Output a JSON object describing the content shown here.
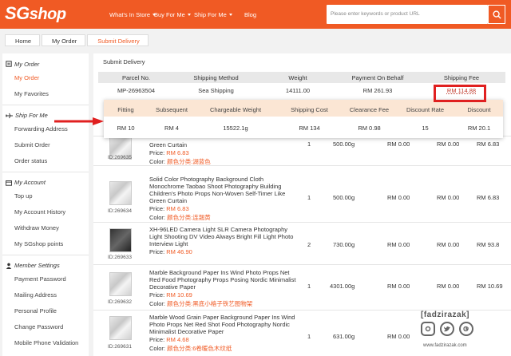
{
  "header": {
    "logo_prefix": "SG",
    "logo_suffix": "shop",
    "nav": [
      "What's In Store",
      "Buy For Me",
      "Ship For Me",
      "Blog"
    ],
    "search_placeholder": "Please enter keywords or product URL"
  },
  "breadcrumb": [
    "Home",
    "My Order",
    "Submit Delivery"
  ],
  "sidebar": {
    "sections": [
      {
        "title": "My Order",
        "icon": "cart-icon",
        "items": [
          "My Order",
          "My Favorites"
        ]
      },
      {
        "title": "Ship For Me",
        "icon": "plane-icon",
        "items": [
          "Forwarding Address",
          "Submit Order",
          "Order status"
        ]
      },
      {
        "title": "My Account",
        "icon": "account-icon",
        "items": [
          "Top up",
          "My Account History",
          "Withdraw Money",
          "My SGshop points"
        ]
      },
      {
        "title": "Member Settings",
        "icon": "user-icon",
        "items": [
          "Payment Password",
          "Mailing Address",
          "Personal Profile",
          "Change Password",
          "Mobile Phone Validation"
        ]
      }
    ],
    "active_item": "My Order"
  },
  "main": {
    "title": "Submit Delivery",
    "shipment": {
      "headers": [
        "Parcel No.",
        "Shipping Method",
        "Weight",
        "Payment On Behalf",
        "Shipping Fee"
      ],
      "row": [
        "MP-26963504",
        "Sea Shipping",
        "14111.00",
        "RM 261.93",
        "RM 114.88"
      ]
    },
    "fee_detail": {
      "headers": [
        "Fitting",
        "Subsequent",
        "Chargeable Weight",
        "Shipping Cost",
        "Clearance Fee",
        "Discount Rate",
        "Discount"
      ],
      "row": [
        "RM 10",
        "RM 4",
        "15522.1g",
        "RM 134",
        "RM 0.98",
        "15",
        "RM 20.1"
      ]
    }
  },
  "products": [
    {
      "name_lines": [
        "Green Curtain"
      ],
      "price_label": "Price:",
      "price": "RM 6.83",
      "color_label": "Color:",
      "color": "颜色分类:湖蓝色",
      "id": "ID:269635",
      "qty": "1",
      "weight": "500.00g",
      "c1": "RM 0.00",
      "c2": "RM 0.00",
      "c3": "RM 6.83"
    },
    {
      "name_lines": [
        "Solid Color Photography Background Cloth",
        "Monochrome Taobao Shoot Photography Building",
        "Children's Photo Props Non-Woven Self-Timer Like",
        "Green Curtain"
      ],
      "price_label": "Price:",
      "price": "RM 6.83",
      "color_label": "Color:",
      "color": "颜色分类:连翘黄",
      "id": "ID:269634",
      "qty": "1",
      "weight": "500.00g",
      "c1": "RM 0.00",
      "c2": "RM 0.00",
      "c3": "RM 6.83"
    },
    {
      "name_lines": [
        "XH-96LED Camera Light SLR Camera Photography",
        "Light Shooting DV Video Always Bright Fill Light Photo",
        "Interview Light"
      ],
      "price_label": "Price:",
      "price": "RM 46.90",
      "color_label": "",
      "color": "",
      "id": "ID:269633",
      "qty": "2",
      "weight": "730.00g",
      "c1": "RM 0.00",
      "c2": "RM 0.00",
      "c3": "RM 93.8"
    },
    {
      "name_lines": [
        "Marble Background Paper Ins Wind Photo Props Net",
        "Red Food Photography Props Posing Nordic Minimalist",
        "Decorative Paper"
      ],
      "price_label": "Price:",
      "price": "RM 10.69",
      "color_label": "Color:",
      "color": "颜色分类:黑底小格子铁艺图物架",
      "id": "ID:269632",
      "qty": "1",
      "weight": "4301.00g",
      "c1": "RM 0.00",
      "c2": "RM 0.00",
      "c3": "RM 10.69"
    },
    {
      "name_lines": [
        "Marble Wood Grain Paper Background Paper Ins Wind",
        "Photo Props Net Red Shot Food Photography Nordic",
        "Minimalist Decorative Paper"
      ],
      "price_label": "Price:",
      "price": "RM 4.68",
      "color_label": "Color:",
      "color": "颜色分类:6卷暖色木纹纸",
      "id": "ID:269631",
      "qty": "1",
      "weight": "631.00g",
      "c1": "RM 0.00",
      "c2": "RM 0.00",
      "c3": "RM 4.68"
    }
  ],
  "watermark": {
    "handle": "[fadzirazak]",
    "url": "www.fadzirazak.com",
    "icons": [
      "instagram-icon",
      "twitter-icon",
      "google-plus-icon"
    ]
  }
}
